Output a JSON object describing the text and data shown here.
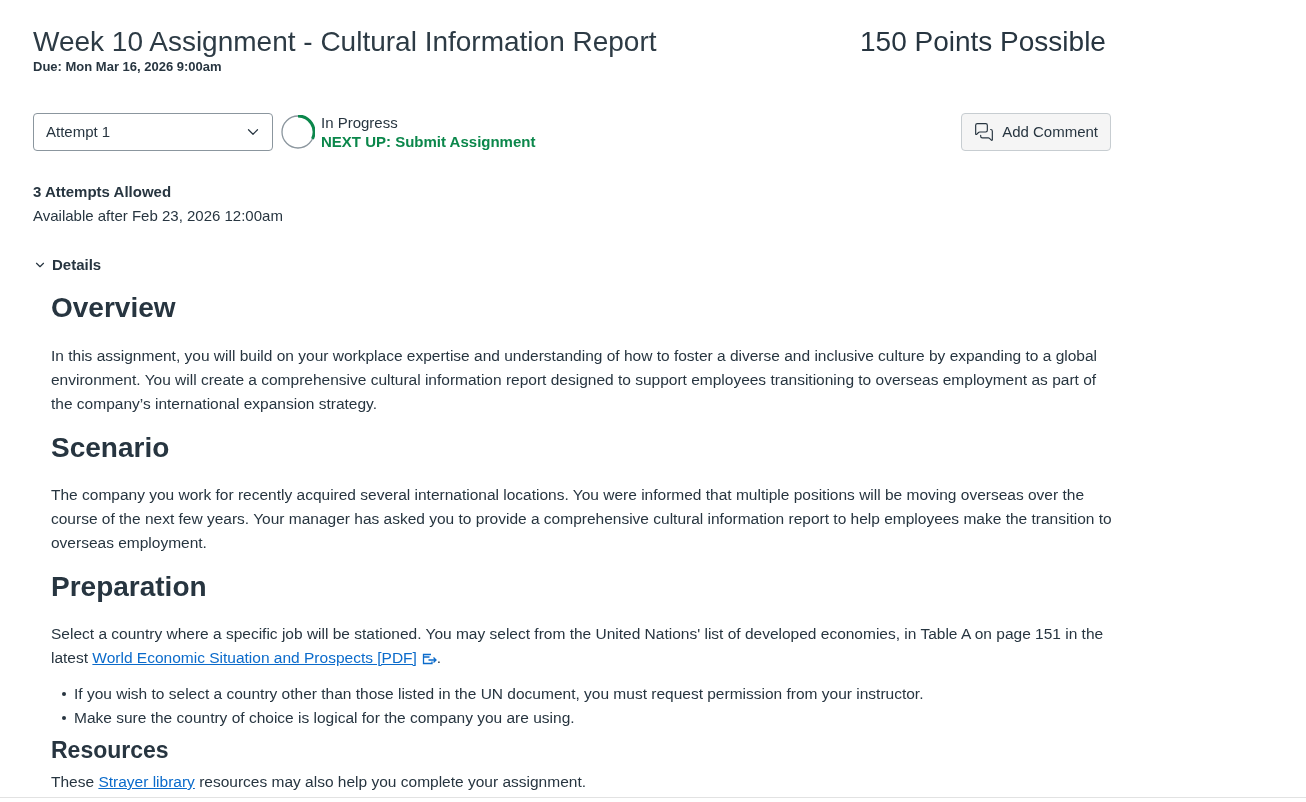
{
  "header": {
    "title": "Week 10 Assignment - Cultural Information Report",
    "due": "Due: Mon Mar 16, 2026 9:00am",
    "points": "150 Points Possible"
  },
  "attempt_select": {
    "value": "Attempt 1"
  },
  "status": {
    "label": "In Progress",
    "next_up": "NEXT UP: Submit Assignment"
  },
  "add_comment_button": {
    "label": "Add Comment"
  },
  "attempts_allowed": "3 Attempts Allowed",
  "available": "Available after Feb 23, 2026 12:00am",
  "details": {
    "label": "Details",
    "expanded": true,
    "blocks": [
      {
        "kind": "heading",
        "text": "Overview"
      },
      {
        "kind": "paragraph",
        "parts": [
          {
            "text": "In this assignment, you will build on your workplace expertise and understanding of how to foster a diverse and inclusive culture by expanding to a global environment. You will create a comprehensive cultural information report designed to support employees transitioning to overseas employment as part of the company’s international expansion strategy."
          }
        ]
      },
      {
        "kind": "heading",
        "text": "Scenario"
      },
      {
        "kind": "paragraph",
        "parts": [
          {
            "text": "The company you work for recently acquired several international locations. You were informed that multiple positions will be moving overseas over the course of the next few years. Your manager has asked you to provide a comprehensive cultural information report to help employees make the transition to overseas employment."
          }
        ]
      },
      {
        "kind": "heading",
        "text": "Preparation"
      },
      {
        "kind": "paragraph",
        "parts": [
          {
            "text": "Select a country where a specific job will be stationed. You may select from the United Nations' list of developed economies, in Table A on page 151 in the latest "
          },
          {
            "link": "World Economic Situation and Prospects [PDF]",
            "external": true
          },
          {
            "text": "."
          }
        ]
      },
      {
        "kind": "bullets",
        "items": [
          "If you wish to select a country other than those listed in the UN document, you must request permission from your instructor.",
          "Make sure the country of choice is logical for the company you are using."
        ]
      },
      {
        "kind": "subheading",
        "text": "Resources"
      },
      {
        "kind": "paragraph",
        "parts": [
          {
            "text": "These "
          },
          {
            "link": "Strayer library",
            "external": false
          },
          {
            "text": " resources may also help you complete your assignment."
          }
        ]
      }
    ]
  }
}
